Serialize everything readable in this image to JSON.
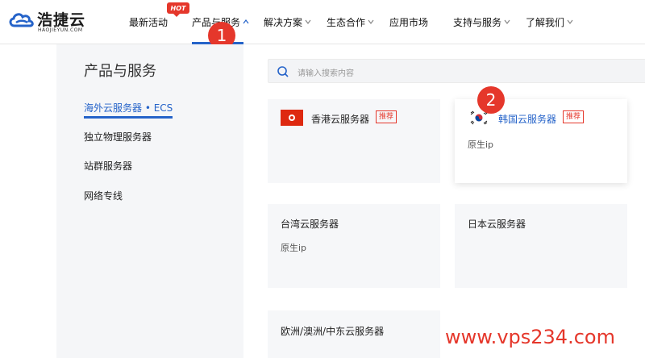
{
  "brand": {
    "name": "浩捷云",
    "sub": "HAOJIEYUN.COM",
    "primary_color": "#2563c9",
    "accent_color": "#e5372b"
  },
  "nav": {
    "items": [
      {
        "label": "最新活动",
        "has_chevron": false
      },
      {
        "label": "产品与服务",
        "has_chevron": true,
        "active": true
      },
      {
        "label": "解决方案",
        "has_chevron": true
      },
      {
        "label": "生态合作",
        "has_chevron": true
      },
      {
        "label": "应用市场",
        "has_chevron": false
      },
      {
        "label": "支持与服务",
        "has_chevron": true
      },
      {
        "label": "了解我们",
        "has_chevron": true
      }
    ],
    "hot_badge": "HOT"
  },
  "markers": {
    "step1": "1",
    "step2": "2"
  },
  "sidebar": {
    "title": "产品与服务",
    "items": [
      {
        "label": "海外云服务器 • ECS",
        "active": true
      },
      {
        "label": "独立物理服务器"
      },
      {
        "label": "站群服务器"
      },
      {
        "label": "网络专线"
      }
    ]
  },
  "search": {
    "placeholder": "请输入搜索内容"
  },
  "cards": [
    {
      "title": "香港云服务器",
      "tag": "推荐",
      "subtitle": "",
      "flag": "hk"
    },
    {
      "title": "韩国云服务器",
      "tag": "推荐",
      "subtitle": "原生ip",
      "flag": "kr"
    },
    {
      "title": "台湾云服务器",
      "tag": "",
      "subtitle": "原生ip",
      "flag": ""
    },
    {
      "title": "日本云服务器",
      "tag": "",
      "subtitle": "",
      "flag": ""
    },
    {
      "title": "欧洲/澳洲/中东云服务器",
      "tag": "",
      "subtitle": "",
      "flag": ""
    }
  ],
  "watermark": "www.vps234.com"
}
